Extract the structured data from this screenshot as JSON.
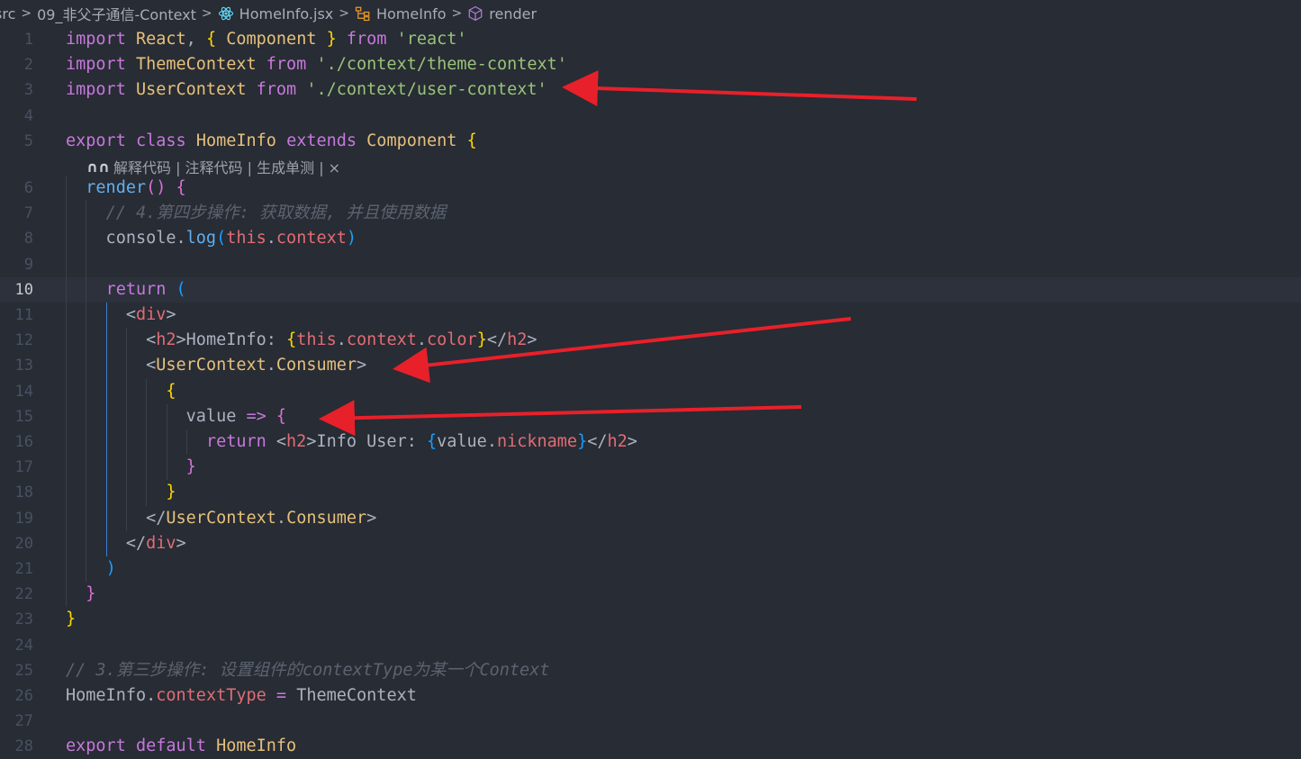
{
  "breadcrumb": {
    "items": [
      "src",
      "09_非父子通信-Context",
      "HomeInfo.jsx",
      "HomeInfo",
      "render"
    ],
    "icons": [
      "",
      "",
      "react-icon",
      "class-icon",
      "method-icon"
    ]
  },
  "editor": {
    "active_line": 10,
    "codelens": "解释代码 | 注释代码 | 生成单测 | ×",
    "lines": [
      {
        "n": "1",
        "t": [
          [
            "k",
            "import"
          ],
          [
            "p",
            " "
          ],
          [
            "i",
            "React"
          ],
          [
            "p",
            ", "
          ],
          [
            "b1",
            "{"
          ],
          [
            "p",
            " "
          ],
          [
            "i",
            "Component"
          ],
          [
            "p",
            " "
          ],
          [
            "b1",
            "}"
          ],
          [
            "p",
            " "
          ],
          [
            "k",
            "from"
          ],
          [
            "p",
            " "
          ],
          [
            "s",
            "'react'"
          ]
        ]
      },
      {
        "n": "2",
        "t": [
          [
            "k",
            "import"
          ],
          [
            "p",
            " "
          ],
          [
            "i",
            "ThemeContext"
          ],
          [
            "p",
            " "
          ],
          [
            "k",
            "from"
          ],
          [
            "p",
            " "
          ],
          [
            "s",
            "'./context/theme-context'"
          ]
        ]
      },
      {
        "n": "3",
        "t": [
          [
            "k",
            "import"
          ],
          [
            "p",
            " "
          ],
          [
            "i",
            "UserContext"
          ],
          [
            "p",
            " "
          ],
          [
            "k",
            "from"
          ],
          [
            "p",
            " "
          ],
          [
            "s",
            "'./context/user-context'"
          ]
        ]
      },
      {
        "n": "4",
        "t": []
      },
      {
        "n": "5",
        "t": [
          [
            "k",
            "export"
          ],
          [
            "p",
            " "
          ],
          [
            "k",
            "class"
          ],
          [
            "p",
            " "
          ],
          [
            "i",
            "HomeInfo"
          ],
          [
            "p",
            " "
          ],
          [
            "k",
            "extends"
          ],
          [
            "p",
            " "
          ],
          [
            "i",
            "Component"
          ],
          [
            "p",
            " "
          ],
          [
            "b1",
            "{"
          ]
        ]
      },
      {
        "n": "6",
        "t": [
          [
            "p",
            "  "
          ],
          [
            "f",
            "render"
          ],
          [
            "b2",
            "()"
          ],
          [
            "p",
            " "
          ],
          [
            "b2",
            "{"
          ]
        ]
      },
      {
        "n": "7",
        "t": [
          [
            "p",
            "    "
          ],
          [
            "cm",
            "// 4.第四步操作: 获取数据, 并且使用数据"
          ]
        ]
      },
      {
        "n": "8",
        "t": [
          [
            "p",
            "    console."
          ],
          [
            "f",
            "log"
          ],
          [
            "b3",
            "("
          ],
          [
            "v",
            "this"
          ],
          [
            "p",
            "."
          ],
          [
            "v",
            "context"
          ],
          [
            "b3",
            ")"
          ]
        ]
      },
      {
        "n": "9",
        "t": []
      },
      {
        "n": "10",
        "t": [
          [
            "p",
            "    "
          ],
          [
            "k",
            "return"
          ],
          [
            "p",
            " "
          ],
          [
            "b3",
            "("
          ]
        ]
      },
      {
        "n": "11",
        "t": [
          [
            "p",
            "      <"
          ],
          [
            "tag",
            "div"
          ],
          [
            "p",
            ">"
          ]
        ]
      },
      {
        "n": "12",
        "t": [
          [
            "p",
            "        <"
          ],
          [
            "tag",
            "h2"
          ],
          [
            "p",
            ">HomeInfo: "
          ],
          [
            "b1",
            "{"
          ],
          [
            "v",
            "this"
          ],
          [
            "p",
            "."
          ],
          [
            "v",
            "context"
          ],
          [
            "p",
            "."
          ],
          [
            "v",
            "color"
          ],
          [
            "b1",
            "}"
          ],
          [
            "p",
            "</"
          ],
          [
            "tag",
            "h2"
          ],
          [
            "p",
            ">"
          ]
        ]
      },
      {
        "n": "13",
        "t": [
          [
            "p",
            "        <"
          ],
          [
            "comp",
            "UserContext"
          ],
          [
            "p",
            "."
          ],
          [
            "comp",
            "Consumer"
          ],
          [
            "p",
            ">"
          ]
        ]
      },
      {
        "n": "14",
        "t": [
          [
            "p",
            "          "
          ],
          [
            "b1",
            "{"
          ]
        ]
      },
      {
        "n": "15",
        "t": [
          [
            "p",
            "            value "
          ],
          [
            "k",
            "=>"
          ],
          [
            "p",
            " "
          ],
          [
            "b2",
            "{"
          ]
        ]
      },
      {
        "n": "16",
        "t": [
          [
            "p",
            "              "
          ],
          [
            "k",
            "return"
          ],
          [
            "p",
            " <"
          ],
          [
            "tag",
            "h2"
          ],
          [
            "p",
            ">Info User: "
          ],
          [
            "b3",
            "{"
          ],
          [
            "p",
            "value."
          ],
          [
            "v",
            "nickname"
          ],
          [
            "b3",
            "}"
          ],
          [
            "p",
            "</"
          ],
          [
            "tag",
            "h2"
          ],
          [
            "p",
            ">"
          ]
        ]
      },
      {
        "n": "17",
        "t": [
          [
            "p",
            "            "
          ],
          [
            "b2",
            "}"
          ]
        ]
      },
      {
        "n": "18",
        "t": [
          [
            "p",
            "          "
          ],
          [
            "b1",
            "}"
          ]
        ]
      },
      {
        "n": "19",
        "t": [
          [
            "p",
            "        </"
          ],
          [
            "comp",
            "UserContext"
          ],
          [
            "p",
            "."
          ],
          [
            "comp",
            "Consumer"
          ],
          [
            "p",
            ">"
          ]
        ]
      },
      {
        "n": "20",
        "t": [
          [
            "p",
            "      </"
          ],
          [
            "tag",
            "div"
          ],
          [
            "p",
            ">"
          ]
        ]
      },
      {
        "n": "21",
        "t": [
          [
            "p",
            "    "
          ],
          [
            "b3",
            ")"
          ]
        ]
      },
      {
        "n": "22",
        "t": [
          [
            "p",
            "  "
          ],
          [
            "b2",
            "}"
          ]
        ]
      },
      {
        "n": "23",
        "t": [
          [
            "b1",
            "}"
          ]
        ]
      },
      {
        "n": "24",
        "t": []
      },
      {
        "n": "25",
        "t": [
          [
            "cm",
            "// 3.第三步操作: 设置组件的contextType为某一个Context"
          ]
        ]
      },
      {
        "n": "26",
        "t": [
          [
            "p",
            "HomeInfo."
          ],
          [
            "v",
            "contextType"
          ],
          [
            "p",
            " "
          ],
          [
            "k",
            "="
          ],
          [
            "p",
            " ThemeContext"
          ]
        ]
      },
      {
        "n": "27",
        "t": []
      },
      {
        "n": "28",
        "t": [
          [
            "k",
            "export"
          ],
          [
            "p",
            " "
          ],
          [
            "k",
            "default"
          ],
          [
            "p",
            " "
          ],
          [
            "i",
            "HomeInfo"
          ]
        ]
      }
    ]
  },
  "colors": {
    "background": "#282c34",
    "annotation_arrow": "#e8202a"
  }
}
